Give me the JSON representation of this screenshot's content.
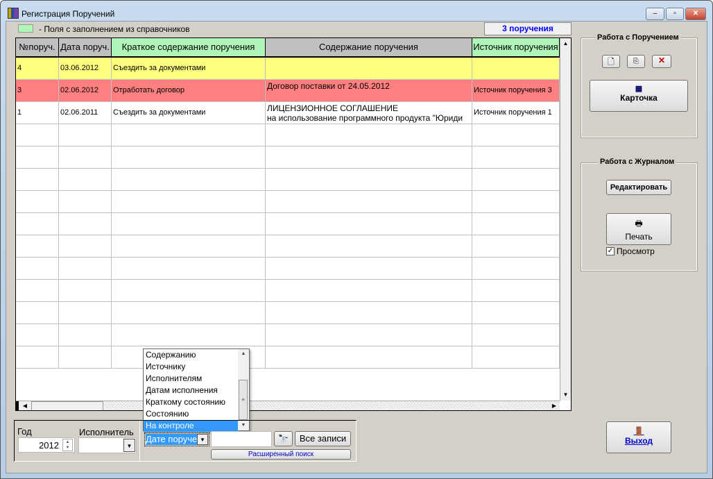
{
  "window": {
    "title": "Регистрация Поручений"
  },
  "legend": {
    "text": "- Поля с заполнением из справочников",
    "color": "#b0f5b8"
  },
  "count_label": "3 поручения",
  "table": {
    "columns": [
      "№поруч.",
      "Дата поруч.",
      "Краткое содержание поручения",
      "Содержание поручения",
      "Источник поручения"
    ],
    "rows": [
      {
        "num": "4",
        "date": "03.06.2012",
        "short": "Съездить за документами",
        "content": "",
        "content2": "",
        "source": "",
        "color": "#ffff80"
      },
      {
        "num": "3",
        "date": "02.06.2012",
        "short": "Отработать договор",
        "content": "Договор поставки от 24.05.2012",
        "content2": "",
        "source": "Источник поручения 3",
        "color": "#ff8080"
      },
      {
        "num": "1",
        "date": "02.06.2011",
        "short": "Съездить за документами",
        "content": "ЛИЦЕНЗИОННОЕ СОГЛАШЕНИЕ",
        "content2": "на использование программного продукта \"Юриди",
        "source": "Источник поручения 1",
        "color": "#ffffff"
      }
    ]
  },
  "panel_task": {
    "title": "Работа с Поручением",
    "card": "Карточка"
  },
  "panel_journal": {
    "title": "Работа с Журналом",
    "edit": "Редактировать",
    "print": "Печать",
    "preview": "Просмотр",
    "preview_checked": true
  },
  "exit": "Выход",
  "filters": {
    "year_label": "Год",
    "year": "2012",
    "executor_label": "Исполнитель",
    "executor": "",
    "search_by": "Дате поруче",
    "search_text": "",
    "all_records": "Все записи",
    "advanced": "Расширенный поиск"
  },
  "dropdown": {
    "options": [
      "Содержанию",
      "Источнику",
      "Исполнителям",
      "Датам исполнения",
      "Краткому состоянию",
      "Состоянию",
      "На контроле"
    ],
    "selected": "На контроле"
  }
}
